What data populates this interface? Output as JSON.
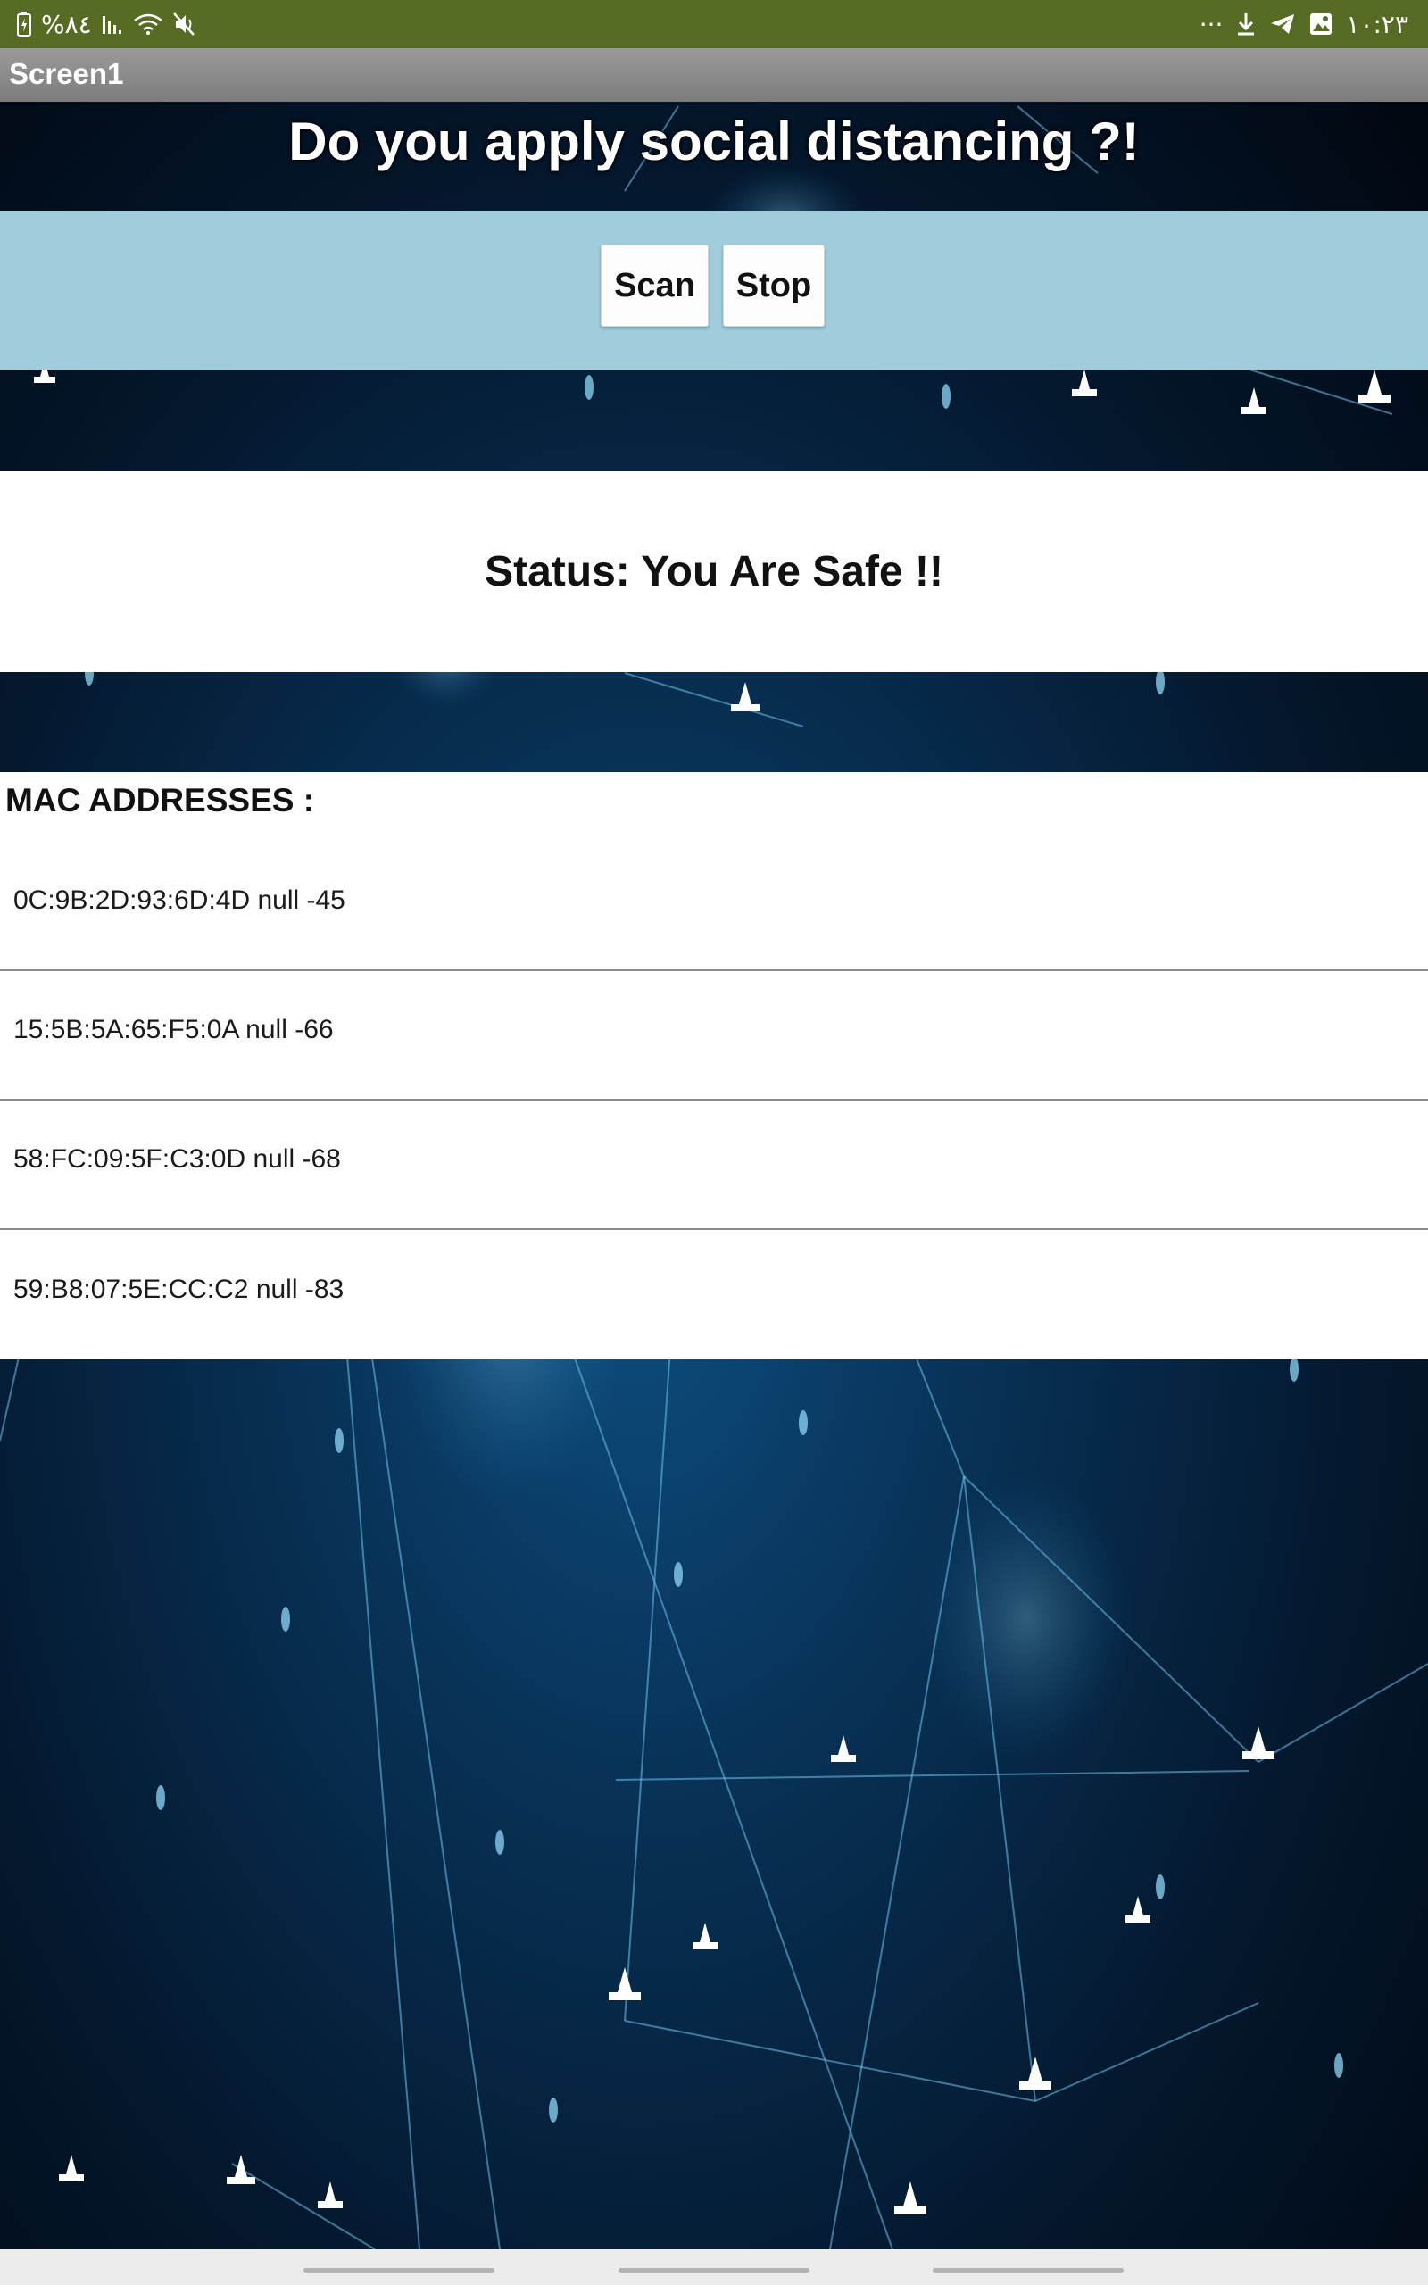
{
  "status_bar": {
    "left_text": "%٨٤",
    "time": "١٠:٢٣",
    "more": "···",
    "icons": [
      "battery-icon",
      "signal-bars-icon",
      "wifi-icon",
      "mute-icon",
      "download-icon",
      "telegram-icon",
      "gallery-icon"
    ]
  },
  "app": {
    "title": "Screen1"
  },
  "headline": "Do you apply social distancing ?!",
  "buttons": {
    "scan": "Scan",
    "stop": "Stop"
  },
  "status": {
    "text": "Status: You Are Safe !!"
  },
  "mac_list": {
    "header": "MAC ADDRESSES :",
    "items": [
      "0C:9B:2D:93:6D:4D null -45",
      "15:5B:5A:65:F5:0A null -66",
      "58:FC:09:5F:C3:0D null -68",
      "59:B8:07:5E:CC:C2 null -83"
    ]
  },
  "colors": {
    "status_bar": "#566b24",
    "title_bar": "#8a8a8a",
    "button_panel": "#a1ccdc",
    "background": "#083257"
  }
}
